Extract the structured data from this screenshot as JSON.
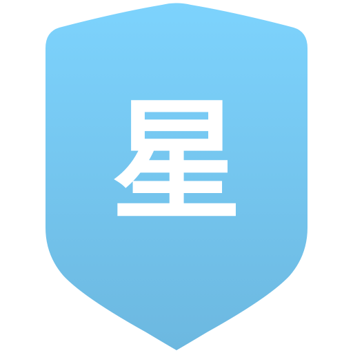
{
  "icon": {
    "name": "shield-icon",
    "character": "星",
    "colors": {
      "gradient_top": "#7dd3fd",
      "gradient_bottom": "#6cb8e0",
      "glyph": "#ffffff"
    }
  }
}
